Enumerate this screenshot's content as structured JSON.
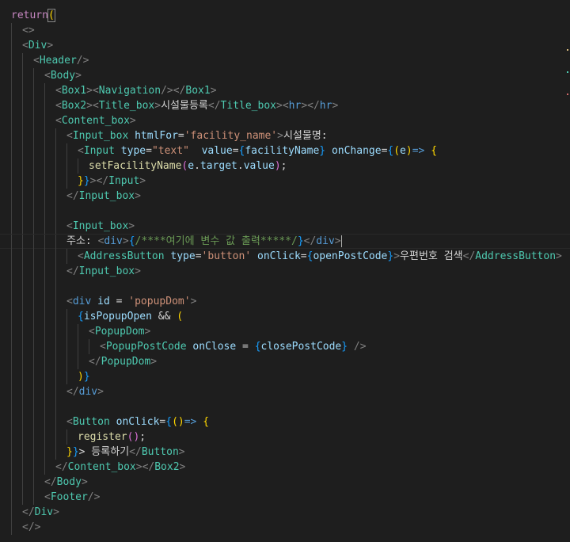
{
  "editor": {
    "lines": [
      {
        "indent": 0,
        "tokens": [
          {
            "t": "return",
            "c": "tok-ctrl"
          },
          {
            "t": "(",
            "c": "tok-brace",
            "m": true
          }
        ]
      },
      {
        "indent": 1,
        "tokens": [
          {
            "t": "<>",
            "c": "tok-punc"
          }
        ]
      },
      {
        "indent": 1,
        "tokens": [
          {
            "t": "<",
            "c": "tok-punc"
          },
          {
            "t": "Div",
            "c": "tok-tag"
          },
          {
            "t": ">",
            "c": "tok-punc"
          }
        ]
      },
      {
        "indent": 2,
        "tokens": [
          {
            "t": "<",
            "c": "tok-punc"
          },
          {
            "t": "Header",
            "c": "tok-tag"
          },
          {
            "t": "/>",
            "c": "tok-punc"
          }
        ]
      },
      {
        "indent": 3,
        "tokens": [
          {
            "t": "<",
            "c": "tok-punc"
          },
          {
            "t": "Body",
            "c": "tok-tag"
          },
          {
            "t": ">",
            "c": "tok-punc"
          }
        ]
      },
      {
        "indent": 4,
        "tokens": [
          {
            "t": "<",
            "c": "tok-punc"
          },
          {
            "t": "Box1",
            "c": "tok-tag"
          },
          {
            "t": "><",
            "c": "tok-punc"
          },
          {
            "t": "Navigation",
            "c": "tok-tag"
          },
          {
            "t": "/></",
            "c": "tok-punc"
          },
          {
            "t": "Box1",
            "c": "tok-tag"
          },
          {
            "t": ">",
            "c": "tok-punc"
          }
        ]
      },
      {
        "indent": 4,
        "tokens": [
          {
            "t": "<",
            "c": "tok-punc"
          },
          {
            "t": "Box2",
            "c": "tok-tag"
          },
          {
            "t": "><",
            "c": "tok-punc"
          },
          {
            "t": "Title_box",
            "c": "tok-tag"
          },
          {
            "t": ">",
            "c": "tok-punc"
          },
          {
            "t": "시설물등록",
            "c": "tok-text"
          },
          {
            "t": "</",
            "c": "tok-punc"
          },
          {
            "t": "Title_box",
            "c": "tok-tag"
          },
          {
            "t": "><",
            "c": "tok-punc"
          },
          {
            "t": "hr",
            "c": "tok-kw"
          },
          {
            "t": "></",
            "c": "tok-punc"
          },
          {
            "t": "hr",
            "c": "tok-kw"
          },
          {
            "t": ">",
            "c": "tok-punc"
          }
        ]
      },
      {
        "indent": 4,
        "tokens": [
          {
            "t": "<",
            "c": "tok-punc"
          },
          {
            "t": "Content_box",
            "c": "tok-tag"
          },
          {
            "t": ">",
            "c": "tok-punc"
          }
        ]
      },
      {
        "indent": 5,
        "tokens": [
          {
            "t": "<",
            "c": "tok-punc"
          },
          {
            "t": "Input_box",
            "c": "tok-tag"
          },
          {
            "t": " ",
            "c": "tok-text"
          },
          {
            "t": "htmlFor",
            "c": "tok-attr"
          },
          {
            "t": "=",
            "c": "tok-text"
          },
          {
            "t": "'facility_name'",
            "c": "tok-str"
          },
          {
            "t": ">",
            "c": "tok-punc"
          },
          {
            "t": "시설물명:",
            "c": "tok-text"
          }
        ]
      },
      {
        "indent": 6,
        "tokens": [
          {
            "t": "<",
            "c": "tok-punc"
          },
          {
            "t": "Input",
            "c": "tok-tag"
          },
          {
            "t": " ",
            "c": "tok-text"
          },
          {
            "t": "type",
            "c": "tok-attr"
          },
          {
            "t": "=",
            "c": "tok-text"
          },
          {
            "t": "\"text\"",
            "c": "tok-str"
          },
          {
            "t": "  ",
            "c": "tok-text"
          },
          {
            "t": "value",
            "c": "tok-attr"
          },
          {
            "t": "=",
            "c": "tok-text"
          },
          {
            "t": "{",
            "c": "tok-brace3"
          },
          {
            "t": "facilityName",
            "c": "tok-var"
          },
          {
            "t": "}",
            "c": "tok-brace3"
          },
          {
            "t": " ",
            "c": "tok-text"
          },
          {
            "t": "onChange",
            "c": "tok-attr"
          },
          {
            "t": "=",
            "c": "tok-text"
          },
          {
            "t": "{",
            "c": "tok-brace3"
          },
          {
            "t": "(",
            "c": "tok-brace"
          },
          {
            "t": "e",
            "c": "tok-var"
          },
          {
            "t": ")",
            "c": "tok-brace"
          },
          {
            "t": "=>",
            "c": "tok-kw"
          },
          {
            "t": " ",
            "c": "tok-text"
          },
          {
            "t": "{",
            "c": "tok-brace"
          }
        ]
      },
      {
        "indent": 7,
        "tokens": [
          {
            "t": "setFacilityName",
            "c": "tok-func"
          },
          {
            "t": "(",
            "c": "tok-brace2"
          },
          {
            "t": "e",
            "c": "tok-var"
          },
          {
            "t": ".",
            "c": "tok-text"
          },
          {
            "t": "target",
            "c": "tok-var"
          },
          {
            "t": ".",
            "c": "tok-text"
          },
          {
            "t": "value",
            "c": "tok-var"
          },
          {
            "t": ")",
            "c": "tok-brace2"
          },
          {
            "t": ";",
            "c": "tok-text"
          }
        ]
      },
      {
        "indent": 6,
        "tokens": [
          {
            "t": "}",
            "c": "tok-brace"
          },
          {
            "t": "}",
            "c": "tok-brace3"
          },
          {
            "t": "></",
            "c": "tok-punc"
          },
          {
            "t": "Input",
            "c": "tok-tag"
          },
          {
            "t": ">",
            "c": "tok-punc"
          }
        ]
      },
      {
        "indent": 5,
        "tokens": [
          {
            "t": "</",
            "c": "tok-punc"
          },
          {
            "t": "Input_box",
            "c": "tok-tag"
          },
          {
            "t": ">",
            "c": "tok-punc"
          }
        ]
      },
      {
        "indent": 5,
        "tokens": []
      },
      {
        "indent": 5,
        "tokens": [
          {
            "t": "<",
            "c": "tok-punc"
          },
          {
            "t": "Input_box",
            "c": "tok-tag"
          },
          {
            "t": ">",
            "c": "tok-punc"
          }
        ]
      },
      {
        "indent": 5,
        "current": true,
        "cursor": true,
        "tokens": [
          {
            "t": "주소: ",
            "c": "tok-text"
          },
          {
            "t": "<",
            "c": "tok-punc"
          },
          {
            "t": "div",
            "c": "tok-kw"
          },
          {
            "t": ">",
            "c": "tok-punc"
          },
          {
            "t": "{",
            "c": "tok-brace3"
          },
          {
            "t": "/****여기에 변수 값 출력*****/",
            "c": "tok-comment"
          },
          {
            "t": "}",
            "c": "tok-brace3"
          },
          {
            "t": "</",
            "c": "tok-punc"
          },
          {
            "t": "div",
            "c": "tok-kw"
          },
          {
            "t": ">",
            "c": "tok-punc"
          }
        ]
      },
      {
        "indent": 6,
        "tokens": [
          {
            "t": "<",
            "c": "tok-punc"
          },
          {
            "t": "AddressButton",
            "c": "tok-tag"
          },
          {
            "t": " ",
            "c": "tok-text"
          },
          {
            "t": "type",
            "c": "tok-attr"
          },
          {
            "t": "=",
            "c": "tok-text"
          },
          {
            "t": "'button'",
            "c": "tok-str"
          },
          {
            "t": " ",
            "c": "tok-text"
          },
          {
            "t": "onClick",
            "c": "tok-attr"
          },
          {
            "t": "=",
            "c": "tok-text"
          },
          {
            "t": "{",
            "c": "tok-brace3"
          },
          {
            "t": "openPostCode",
            "c": "tok-var"
          },
          {
            "t": "}",
            "c": "tok-brace3"
          },
          {
            "t": ">",
            "c": "tok-punc"
          },
          {
            "t": "우편번호 검색",
            "c": "tok-text"
          },
          {
            "t": "</",
            "c": "tok-punc"
          },
          {
            "t": "AddressButton",
            "c": "tok-tag"
          },
          {
            "t": ">",
            "c": "tok-punc"
          }
        ]
      },
      {
        "indent": 5,
        "tokens": [
          {
            "t": "</",
            "c": "tok-punc"
          },
          {
            "t": "Input_box",
            "c": "tok-tag"
          },
          {
            "t": ">",
            "c": "tok-punc"
          }
        ]
      },
      {
        "indent": 5,
        "tokens": []
      },
      {
        "indent": 5,
        "tokens": [
          {
            "t": "<",
            "c": "tok-punc"
          },
          {
            "t": "div",
            "c": "tok-kw"
          },
          {
            "t": " ",
            "c": "tok-text"
          },
          {
            "t": "id",
            "c": "tok-attr"
          },
          {
            "t": " = ",
            "c": "tok-text"
          },
          {
            "t": "'popupDom'",
            "c": "tok-str"
          },
          {
            "t": ">",
            "c": "tok-punc"
          }
        ]
      },
      {
        "indent": 6,
        "tokens": [
          {
            "t": "{",
            "c": "tok-brace3"
          },
          {
            "t": "isPopupOpen",
            "c": "tok-var"
          },
          {
            "t": " && ",
            "c": "tok-text"
          },
          {
            "t": "(",
            "c": "tok-brace"
          }
        ]
      },
      {
        "indent": 7,
        "tokens": [
          {
            "t": "<",
            "c": "tok-punc"
          },
          {
            "t": "PopupDom",
            "c": "tok-tag"
          },
          {
            "t": ">",
            "c": "tok-punc"
          }
        ]
      },
      {
        "indent": 8,
        "tokens": [
          {
            "t": "<",
            "c": "tok-punc"
          },
          {
            "t": "PopupPostCode",
            "c": "tok-tag"
          },
          {
            "t": " ",
            "c": "tok-text"
          },
          {
            "t": "onClose",
            "c": "tok-attr"
          },
          {
            "t": " = ",
            "c": "tok-text"
          },
          {
            "t": "{",
            "c": "tok-brace3"
          },
          {
            "t": "closePostCode",
            "c": "tok-var"
          },
          {
            "t": "}",
            "c": "tok-brace3"
          },
          {
            "t": " />",
            "c": "tok-punc"
          }
        ]
      },
      {
        "indent": 7,
        "tokens": [
          {
            "t": "</",
            "c": "tok-punc"
          },
          {
            "t": "PopupDom",
            "c": "tok-tag"
          },
          {
            "t": ">",
            "c": "tok-punc"
          }
        ]
      },
      {
        "indent": 6,
        "tokens": [
          {
            "t": ")",
            "c": "tok-brace"
          },
          {
            "t": "}",
            "c": "tok-brace3"
          }
        ]
      },
      {
        "indent": 5,
        "tokens": [
          {
            "t": "</",
            "c": "tok-punc"
          },
          {
            "t": "div",
            "c": "tok-kw"
          },
          {
            "t": ">",
            "c": "tok-punc"
          }
        ]
      },
      {
        "indent": 5,
        "tokens": []
      },
      {
        "indent": 5,
        "tokens": [
          {
            "t": "<",
            "c": "tok-punc"
          },
          {
            "t": "Button",
            "c": "tok-tag"
          },
          {
            "t": " ",
            "c": "tok-text"
          },
          {
            "t": "onClick",
            "c": "tok-attr"
          },
          {
            "t": "=",
            "c": "tok-text"
          },
          {
            "t": "{",
            "c": "tok-brace3"
          },
          {
            "t": "()",
            "c": "tok-brace"
          },
          {
            "t": "=>",
            "c": "tok-kw"
          },
          {
            "t": " ",
            "c": "tok-text"
          },
          {
            "t": "{",
            "c": "tok-brace"
          }
        ]
      },
      {
        "indent": 6,
        "tokens": [
          {
            "t": "register",
            "c": "tok-func"
          },
          {
            "t": "()",
            "c": "tok-brace2"
          },
          {
            "t": ";",
            "c": "tok-text"
          }
        ]
      },
      {
        "indent": 5,
        "tokens": [
          {
            "t": "}",
            "c": "tok-brace"
          },
          {
            "t": "}",
            "c": "tok-brace3"
          },
          {
            "t": "> 등록하기",
            "c": "tok-text"
          },
          {
            "t": "</",
            "c": "tok-punc"
          },
          {
            "t": "Button",
            "c": "tok-tag"
          },
          {
            "t": ">",
            "c": "tok-punc"
          }
        ]
      },
      {
        "indent": 4,
        "tokens": [
          {
            "t": "</",
            "c": "tok-punc"
          },
          {
            "t": "Content_box",
            "c": "tok-tag"
          },
          {
            "t": "></",
            "c": "tok-punc"
          },
          {
            "t": "Box2",
            "c": "tok-tag"
          },
          {
            "t": ">",
            "c": "tok-punc"
          }
        ]
      },
      {
        "indent": 3,
        "tokens": [
          {
            "t": "</",
            "c": "tok-punc"
          },
          {
            "t": "Body",
            "c": "tok-tag"
          },
          {
            "t": ">",
            "c": "tok-punc"
          }
        ]
      },
      {
        "indent": 3,
        "tokens": [
          {
            "t": "<",
            "c": "tok-punc"
          },
          {
            "t": "Footer",
            "c": "tok-tag"
          },
          {
            "t": "/>",
            "c": "tok-punc"
          }
        ]
      },
      {
        "indent": 1,
        "tokens": [
          {
            "t": "</",
            "c": "tok-punc"
          },
          {
            "t": "Div",
            "c": "tok-tag"
          },
          {
            "t": ">",
            "c": "tok-punc"
          }
        ]
      },
      {
        "indent": 1,
        "tokens": [
          {
            "t": "</>",
            "c": "tok-punc"
          }
        ]
      }
    ]
  },
  "colors": {
    "background": "#1e1e1e",
    "indent_guide": "#404040",
    "current_line_border": "#282828",
    "minimap_marks": [
      "#d7ba7d",
      "#4ec9b0",
      "#d16969"
    ]
  }
}
